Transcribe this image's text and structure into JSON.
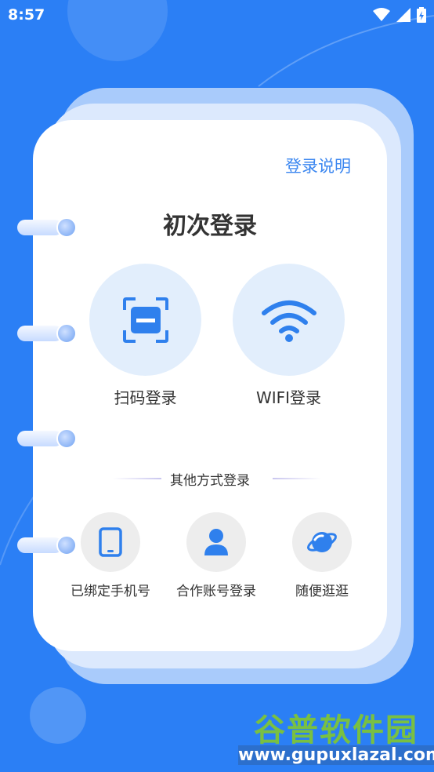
{
  "status_bar": {
    "time": "8:57"
  },
  "card": {
    "help_link": "登录说明",
    "title": "初次登录",
    "primary_options": [
      {
        "label": "扫码登录",
        "icon": "scan-icon"
      },
      {
        "label": "WIFI登录",
        "icon": "wifi-icon"
      }
    ],
    "divider_text": "其他方式登录",
    "secondary_options": [
      {
        "label": "已绑定手机号",
        "icon": "phone-icon"
      },
      {
        "label": "合作账号登录",
        "icon": "user-icon"
      },
      {
        "label": "随便逛逛",
        "icon": "planet-icon"
      }
    ]
  },
  "watermark": {
    "name": "谷普软件园",
    "url": "www.gupuxlazal.com"
  },
  "colors": {
    "background": "#2b7ff5",
    "accent": "#2f80ed",
    "circle_bg": "#e2eefc"
  }
}
